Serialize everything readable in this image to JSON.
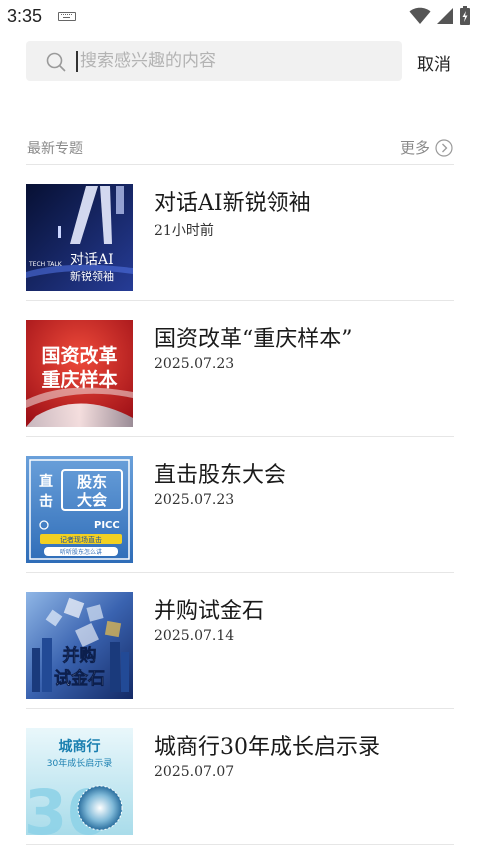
{
  "status": {
    "time": "3:35",
    "icons": [
      "keyboard-icon",
      "wifi-icon",
      "cellular-icon",
      "battery-icon"
    ]
  },
  "search": {
    "placeholder": "搜索感兴趣的内容",
    "value": "",
    "cancel_label": "取消"
  },
  "section": {
    "title": "最新专题",
    "more_label": "更多"
  },
  "topics": [
    {
      "title": "对话AI新锐领袖",
      "date": "21小时前",
      "thumb": {
        "brand": "TECH TALK",
        "line1": "对话AI",
        "line2": "新锐领袖",
        "colors": [
          "#0a1236",
          "#2a3f9a"
        ]
      }
    },
    {
      "title": "国资改革“重庆样本”",
      "date": "2025.07.23",
      "thumb": {
        "line1": "国资改革",
        "line2": "重庆样本",
        "colors": [
          "#b3161d",
          "#e33b2e"
        ]
      }
    },
    {
      "title": "直击股东大会",
      "date": "2025.07.23",
      "thumb": {
        "side1": "直",
        "side2": "击",
        "line1": "股东",
        "line2": "大会",
        "brand": "PICC",
        "tag": "记者现场直击",
        "caption": "听听股东怎么讲",
        "colors": [
          "#5b93d1",
          "#2f6db8"
        ]
      }
    },
    {
      "title": "并购试金石",
      "date": "2025.07.14",
      "thumb": {
        "line1": "并购",
        "line2": "试金石",
        "colors": [
          "#1d3f8c",
          "#7fa8d8"
        ]
      }
    },
    {
      "title": "城商行30年成长启示录",
      "date": "2025.07.07",
      "thumb": {
        "line1": "城商行",
        "line2": "30年成长启示录",
        "big": "30",
        "colors": [
          "#dff3f8",
          "#9fd6e6"
        ]
      }
    }
  ]
}
